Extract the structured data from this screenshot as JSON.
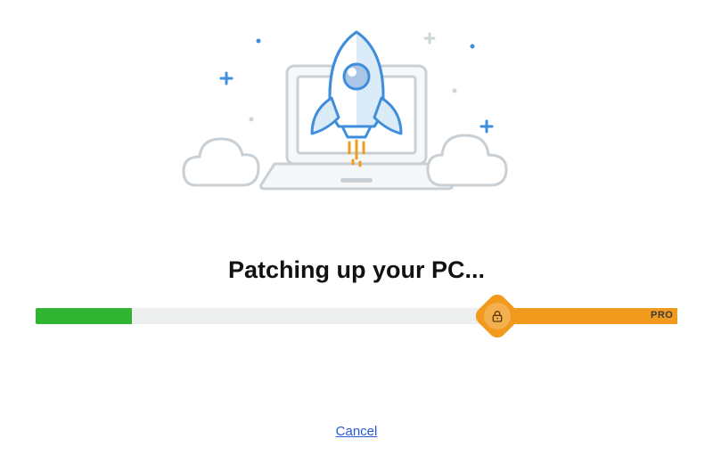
{
  "title": "Patching up your PC...",
  "progress": {
    "done_pct": 15,
    "locked_pct": 28,
    "badge_label": "PRO"
  },
  "cancel_label": "Cancel",
  "colors": {
    "green": "#30b431",
    "orange": "#f19a1e",
    "track": "#eef0ef",
    "link": "#2759d8"
  }
}
